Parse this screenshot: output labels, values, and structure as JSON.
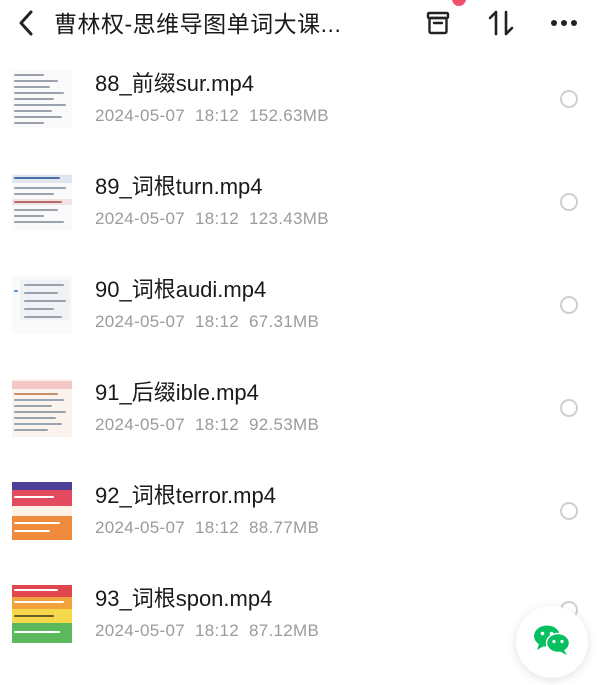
{
  "header": {
    "title": "曹林权-思维导图单词大课...",
    "back_icon": "chevron-left-icon",
    "archive_icon": "archive-box-icon",
    "sort_icon": "sort-updown-icon",
    "more_icon": "ellipsis-horizontal-icon"
  },
  "files": [
    {
      "name": "88_前缀sur.mp4",
      "date": "2024-05-07",
      "time": "18:12",
      "size": "152.63MB"
    },
    {
      "name": "89_词根turn.mp4",
      "date": "2024-05-07",
      "time": "18:12",
      "size": "123.43MB"
    },
    {
      "name": "90_词根audi.mp4",
      "date": "2024-05-07",
      "time": "18:12",
      "size": "67.31MB"
    },
    {
      "name": "91_后缀ible.mp4",
      "date": "2024-05-07",
      "time": "18:12",
      "size": "92.53MB"
    },
    {
      "name": "92_词根terror.mp4",
      "date": "2024-05-07",
      "time": "18:12",
      "size": "88.77MB"
    },
    {
      "name": "93_词根spon.mp4",
      "date": "2024-05-07",
      "time": "18:12",
      "size": "87.12MB"
    }
  ],
  "fab": {
    "icon": "wechat-icon",
    "color": "#07c160"
  },
  "colors": {
    "badge": "#f0506e",
    "text_primary": "#1a1a1a",
    "text_secondary": "#9b9b9b"
  }
}
